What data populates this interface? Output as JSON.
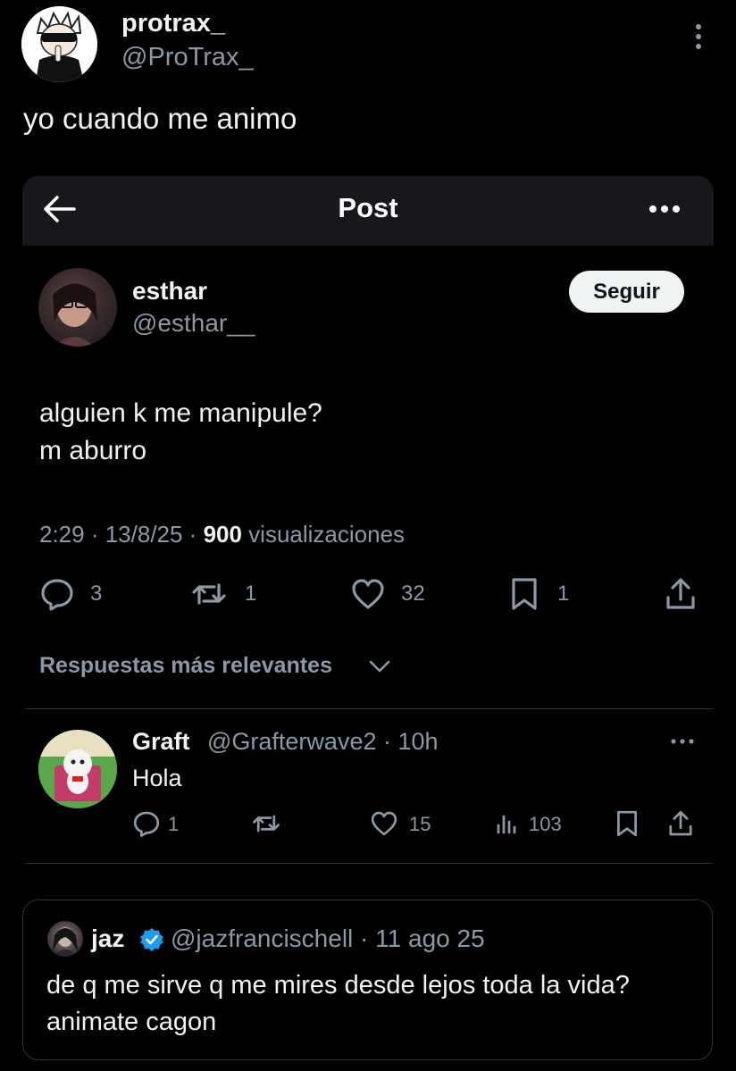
{
  "outer_post": {
    "author_name": "protrax_",
    "author_handle": "@ProTrax_",
    "text": "yo cuando me animo"
  },
  "embedded_screen": {
    "header_title": "Post",
    "post": {
      "author_name": "esthar",
      "author_handle": "@esthar__",
      "follow_label": "Seguir",
      "line1": "alguien k me manipule?",
      "line2": "m aburro",
      "time": "2:29 · 13/8/25 · ",
      "views_count": "900",
      "views_label": " visualizaciones",
      "reply_count": "3",
      "retweet_count": "1",
      "like_count": "32",
      "bookmark_count": "1"
    },
    "sort_label": "Respuestas más relevantes",
    "reply": {
      "author_name": "Graft",
      "meta": "@Grafterwave2 · 10h",
      "text": "Hola",
      "reply_count": "1",
      "like_count": "15",
      "views_count": "103"
    },
    "quoted": {
      "author_name": "jaz",
      "meta": "@jazfrancischell · 11 ago 25",
      "line1": "de q me sirve q me mires desde lejos toda la vida?",
      "line2": "animate cagon"
    }
  },
  "colors": {
    "background": "#000000",
    "text": "#e7e9ea",
    "secondary_text": "#8b98a5",
    "verified": "#1d9bf0",
    "divider": "#2f3336"
  }
}
